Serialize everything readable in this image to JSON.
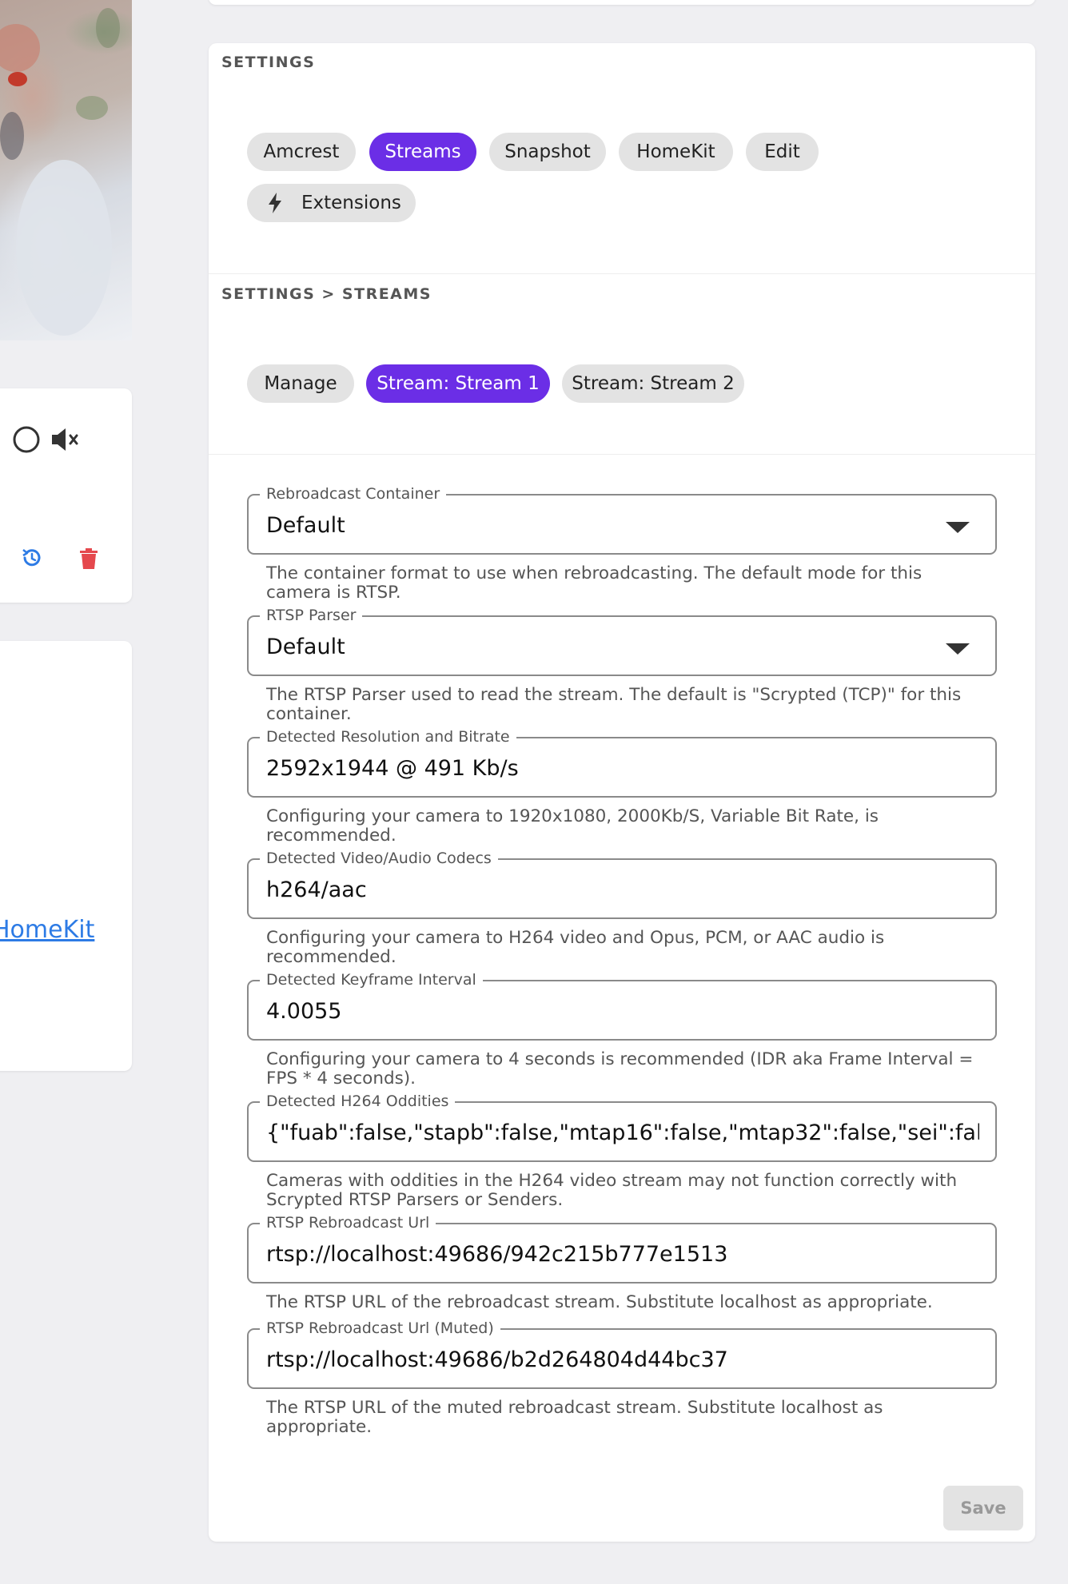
{
  "left": {
    "homekit_link": "HomeKit"
  },
  "settings": {
    "title": "SETTINGS",
    "tabs": [
      "Amcrest",
      "Streams",
      "Snapshot",
      "HomeKit",
      "Edit"
    ],
    "active_tab": "Streams",
    "extensions_label": "Extensions"
  },
  "streams": {
    "title": "SETTINGS > STREAMS",
    "tabs": [
      "Manage",
      "Stream: Stream 1",
      "Stream: Stream 2"
    ],
    "active_tab": "Stream: Stream 1"
  },
  "fields": [
    {
      "label": "Rebroadcast Container",
      "value": "Default",
      "type": "select",
      "hint": "The container format to use when rebroadcasting. The default mode for this camera is RTSP."
    },
    {
      "label": "RTSP Parser",
      "value": "Default",
      "type": "select",
      "hint": "The RTSP Parser used to read the stream. The default is \"Scrypted (TCP)\" for this container."
    },
    {
      "label": "Detected Resolution and Bitrate",
      "value": "2592x1944 @ 491 Kb/s",
      "type": "text",
      "hint": "Configuring your camera to 1920x1080, 2000Kb/S, Variable Bit Rate, is recommended."
    },
    {
      "label": "Detected Video/Audio Codecs",
      "value": "h264/aac",
      "type": "text",
      "hint": "Configuring your camera to H264 video and Opus, PCM, or AAC audio is recommended."
    },
    {
      "label": "Detected Keyframe Interval",
      "value": "4.0055",
      "type": "text",
      "hint": "Configuring your camera to 4 seconds is recommended (IDR aka Frame Interval = FPS * 4 seconds)."
    },
    {
      "label": "Detected H264 Oddities",
      "value": "{\"fuab\":false,\"stapb\":false,\"mtap16\":false,\"mtap32\":false,\"sei\":false,\"reserved\":false}",
      "type": "text",
      "hint": "Cameras with oddities in the H264 video stream may not function correctly with Scrypted RTSP Parsers or Senders."
    },
    {
      "label": "RTSP Rebroadcast Url",
      "value": "rtsp://localhost:49686/942c215b777e1513",
      "type": "text",
      "hint": "The RTSP URL of the rebroadcast stream. Substitute localhost as appropriate."
    },
    {
      "label": "RTSP Rebroadcast Url (Muted)",
      "value": "rtsp://localhost:49686/b2d264804d44bc37",
      "type": "text",
      "hint": "The RTSP URL of the muted rebroadcast stream. Substitute localhost as appropriate."
    }
  ],
  "save_label": "Save",
  "colors": {
    "accent": "#6b2ee6",
    "link": "#2d7be5",
    "danger": "#e5484d"
  },
  "icons": [
    "record-circle-icon",
    "mute-icon",
    "history-icon",
    "trash-icon",
    "bolt-icon",
    "dropdown-caret-icon"
  ]
}
